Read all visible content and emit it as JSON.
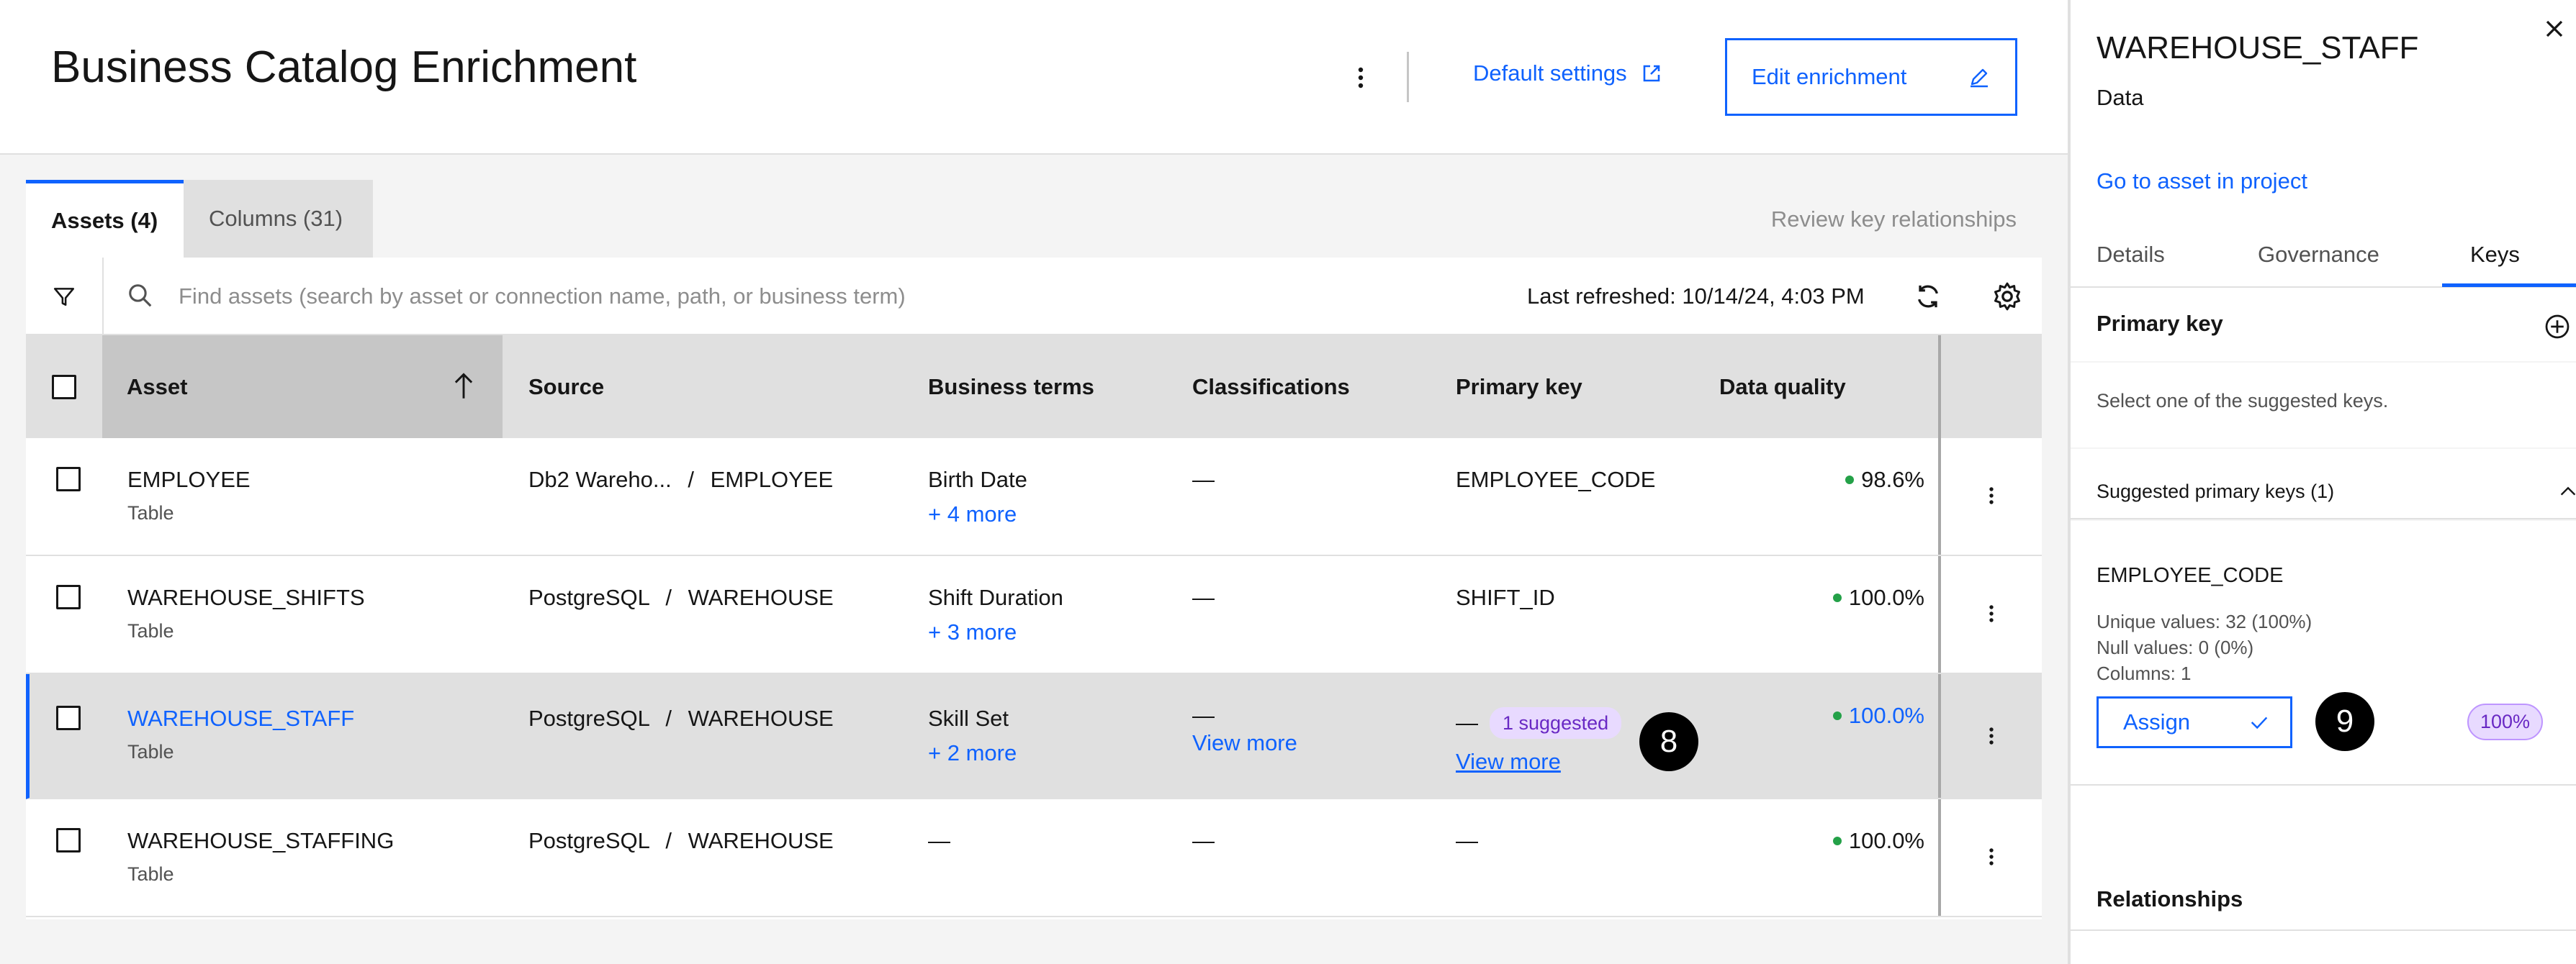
{
  "header": {
    "title": "Business Catalog Enrichment",
    "default_settings": "Default settings",
    "edit_enrichment": "Edit enrichment"
  },
  "tabs": [
    {
      "label": "Assets (4)",
      "active": true
    },
    {
      "label": "Columns (31)",
      "active": false
    }
  ],
  "review_key_relationships": "Review key relationships",
  "toolbar": {
    "search_placeholder": "Find assets (search by asset or connection name, path, or business term)",
    "last_refreshed": "Last refreshed: 10/14/24, 4:03 PM"
  },
  "table": {
    "columns": [
      "Asset",
      "Source",
      "Business terms",
      "Classifications",
      "Primary key",
      "Data quality"
    ],
    "rows": [
      {
        "asset": "EMPLOYEE",
        "type": "Table",
        "source_db": "Db2 Wareho...",
        "source_sep": "/",
        "source_schema": "EMPLOYEE",
        "term": "Birth Date",
        "term_more": "+ 4 more",
        "classification": "—",
        "primary_key": "EMPLOYEE_CODE",
        "quality": "98.6%"
      },
      {
        "asset": "WAREHOUSE_SHIFTS",
        "type": "Table",
        "source_db": "PostgreSQL",
        "source_sep": "/",
        "source_schema": "WAREHOUSE",
        "term": "Shift Duration",
        "term_more": "+ 3 more",
        "classification": "—",
        "primary_key": "SHIFT_ID",
        "quality": "100.0%"
      },
      {
        "asset": "WAREHOUSE_STAFF",
        "type": "Table",
        "source_db": "PostgreSQL",
        "source_sep": "/",
        "source_schema": "WAREHOUSE",
        "term": "Skill Set",
        "term_more": "+ 2 more",
        "classification": "—",
        "classification_more": "View more",
        "primary_key": "—",
        "pk_tag": "1 suggested",
        "pk_more": "View more",
        "quality": "100.0%",
        "step_badge": "8"
      },
      {
        "asset": "WAREHOUSE_STAFFING",
        "type": "Table",
        "source_db": "PostgreSQL",
        "source_sep": "/",
        "source_schema": "WAREHOUSE",
        "term": "—",
        "classification": "—",
        "primary_key": "—",
        "quality": "100.0%"
      }
    ]
  },
  "side_panel": {
    "title": "WAREHOUSE_STAFF",
    "type": "Data",
    "go_to_asset": "Go to asset in project",
    "tabs": [
      "Details",
      "Governance",
      "Keys"
    ],
    "active_tab": "Keys",
    "primary_key_title": "Primary key",
    "hint": "Select one of the suggested keys.",
    "suggested_title": "Suggested primary keys (1)",
    "key": {
      "name": "EMPLOYEE_CODE",
      "unique_values": "Unique values: 32 (100%)",
      "null_values": "Null values: 0 (0%)",
      "columns": "Columns: 1",
      "assign": "Assign",
      "confidence": "100%",
      "step_badge": "9"
    },
    "relationships_title": "Relationships"
  },
  "colors": {
    "accent": "#0f62fe",
    "tag_bg": "#e8daff",
    "tag_text": "#6929c4",
    "quality_dot": "#24a148"
  }
}
